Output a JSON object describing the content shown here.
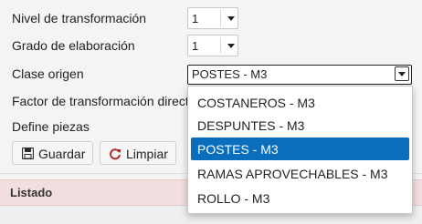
{
  "form": {
    "nivel_label": "Nivel de transformación",
    "nivel_value": "1",
    "grado_label": "Grado de elaboración",
    "grado_value": "1",
    "clase_label": "Clase origen",
    "clase_value": "POSTES - M3",
    "factor_label": "Factor de transformación directa",
    "piezas_label": "Define piezas"
  },
  "buttons": {
    "guardar": "Guardar",
    "limpiar": "Limpiar"
  },
  "listado": {
    "title": "Listado"
  },
  "dropdown": {
    "options": [
      "COSTANEROS - M3",
      "DESPUNTES - M3",
      "POSTES - M3",
      "RAMAS APROVECHABLES - M3",
      "ROLLO - M3"
    ],
    "selected_index": 2
  },
  "colors": {
    "selected_bg": "#0a6ebd",
    "listado_bg": "#f2dede",
    "page_bg": "#f4f4f4"
  },
  "icons": [
    "save-icon",
    "refresh-icon",
    "chevron-down-icon"
  ]
}
